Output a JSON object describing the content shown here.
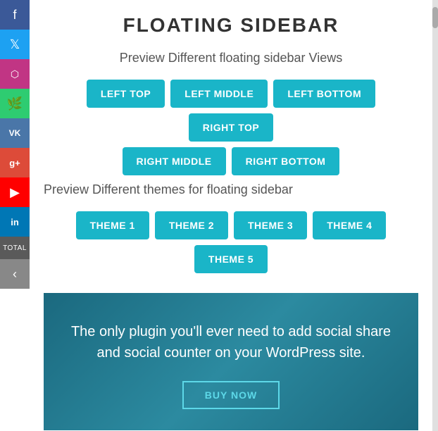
{
  "page": {
    "title": "FLOATING SIDEBAR"
  },
  "sidebar": {
    "items": [
      {
        "icon": "f",
        "label": "Facebook",
        "class": "facebook"
      },
      {
        "icon": "t",
        "label": "Twitter",
        "class": "twitter"
      },
      {
        "icon": "📷",
        "label": "Instagram",
        "class": "instagram"
      },
      {
        "icon": "🌿",
        "label": "Leaf",
        "class": "leaf"
      },
      {
        "icon": "vk",
        "label": "VK",
        "class": "vk"
      },
      {
        "icon": "g+",
        "label": "Google Plus",
        "class": "google"
      },
      {
        "icon": "▶",
        "label": "YouTube",
        "class": "youtube"
      },
      {
        "icon": "in",
        "label": "LinkedIn",
        "class": "linkedin"
      },
      {
        "icon": "Total",
        "label": "Total",
        "class": "total-label"
      },
      {
        "icon": "‹",
        "label": "Arrow",
        "class": "arrow"
      }
    ]
  },
  "preview_views": {
    "subtitle": "Preview Different floating sidebar Views",
    "buttons": [
      "LEFT TOP",
      "LEFT MIDDLE",
      "LEFT BOTTOM",
      "RIGHT TOP",
      "RIGHT MIDDLE",
      "RIGHT BOTTOM"
    ]
  },
  "preview_themes": {
    "subtitle": "Preview Different themes for floating sidebar",
    "buttons": [
      "THEME 1",
      "THEME 2",
      "THEME 3",
      "THEME 4",
      "THEME 5"
    ]
  },
  "bottom": {
    "text": "The only plugin you'll ever need to add social share and social counter on your WordPress site.",
    "buy_button": "BUY NOW"
  }
}
